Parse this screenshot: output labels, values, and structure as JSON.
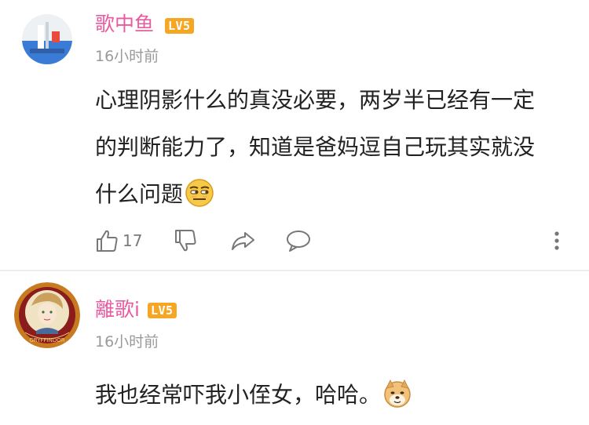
{
  "comments": [
    {
      "username": "歌中鱼",
      "level": "LV5",
      "time": "16小时前",
      "content_lines": [
        "心理阴影什么的真没必要，两岁半已经有一定",
        "的判断能力了，知道是爸妈逗自己玩其实就没",
        "什么问题"
      ],
      "emoji": "smug-face-emoji",
      "likes": "17",
      "actions": [
        "thumbs-up-icon",
        "thumbs-down-icon",
        "share-icon",
        "comment-icon",
        "more-icon"
      ]
    },
    {
      "username": "離歌i",
      "level": "LV5",
      "time": "16小时前",
      "avatar_text": "GRYFFINDOR",
      "content_lines": [
        "我也经常吓我小侄女，哈哈。"
      ],
      "emoji": "doge-emoji"
    }
  ],
  "colors": {
    "username": "#e85ba0",
    "level_badge": "#f5a623",
    "timestamp": "#9a9a9a",
    "text": "#222222",
    "icon": "#777777"
  }
}
